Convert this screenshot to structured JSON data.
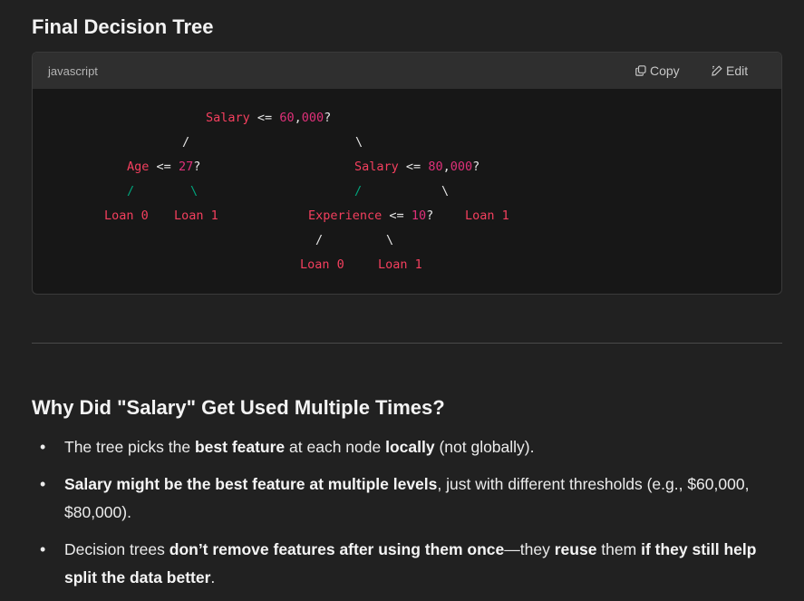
{
  "headings": {
    "tree": "Final Decision Tree",
    "why": "Why Did \"Salary\" Get Used Multiple Times?"
  },
  "code": {
    "language": "javascript",
    "copy_label": "Copy",
    "edit_label": "Edit",
    "root": {
      "feature": "Salary",
      "op": "<=",
      "num_a": "60",
      "comma": ",",
      "num_b": "000",
      "q": "?"
    },
    "left": {
      "feature": "Age",
      "op": "<=",
      "num": "27",
      "q": "?"
    },
    "right": {
      "feature": "Salary",
      "op": "<=",
      "num_a": "80",
      "comma": ",",
      "num_b": "000",
      "q": "?"
    },
    "right_left": {
      "feature": "Experience",
      "op": "<=",
      "num": "10",
      "q": "?"
    },
    "leaves": {
      "age_yes": "Loan 0",
      "age_no": "Loan 1",
      "salary80_no": "Loan 1",
      "exp_yes": "Loan 0",
      "exp_no": "Loan 1"
    },
    "branch_left": "/",
    "branch_right": "\\"
  },
  "bullets": [
    {
      "a": "The tree picks the ",
      "b": "best feature",
      "c": " at each node ",
      "d": "locally",
      "e": " (not globally)."
    },
    {
      "a": "Salary might be the best feature at multiple levels",
      "b": ", just with different thresholds (e.g., $60,000, $80,000)."
    },
    {
      "a": "Decision trees ",
      "b": "don’t remove features after using them once",
      "c": "—they ",
      "d": "reuse",
      "e": " them ",
      "f": "if they still help split the data better",
      "g": "."
    }
  ],
  "icons": {
    "copy": "copy-icon",
    "edit": "pencil-icon"
  }
}
